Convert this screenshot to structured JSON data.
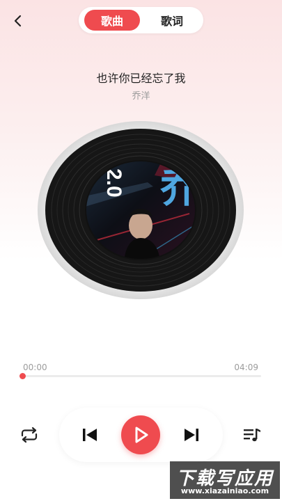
{
  "header": {
    "tabs": [
      {
        "label": "歌曲",
        "active": true
      },
      {
        "label": "歌词",
        "active": false
      }
    ]
  },
  "song": {
    "title": "也许你已经忘了我",
    "artist": "乔洋"
  },
  "cover_art": {
    "text_big": "乔",
    "text_vertical": "2.0"
  },
  "progress": {
    "current": "00:00",
    "total": "04:09",
    "fraction": 0.0
  },
  "controls": {
    "repeat": "repeat-icon",
    "prev": "skip-previous-icon",
    "play": "play-icon",
    "next": "skip-next-icon",
    "playlist": "playlist-icon"
  },
  "colors": {
    "accent": "#ef4b4f",
    "background_top": "#fbe3e4"
  },
  "watermark": {
    "logo": "下载写应用",
    "url": "www.xiazainiao.com"
  }
}
